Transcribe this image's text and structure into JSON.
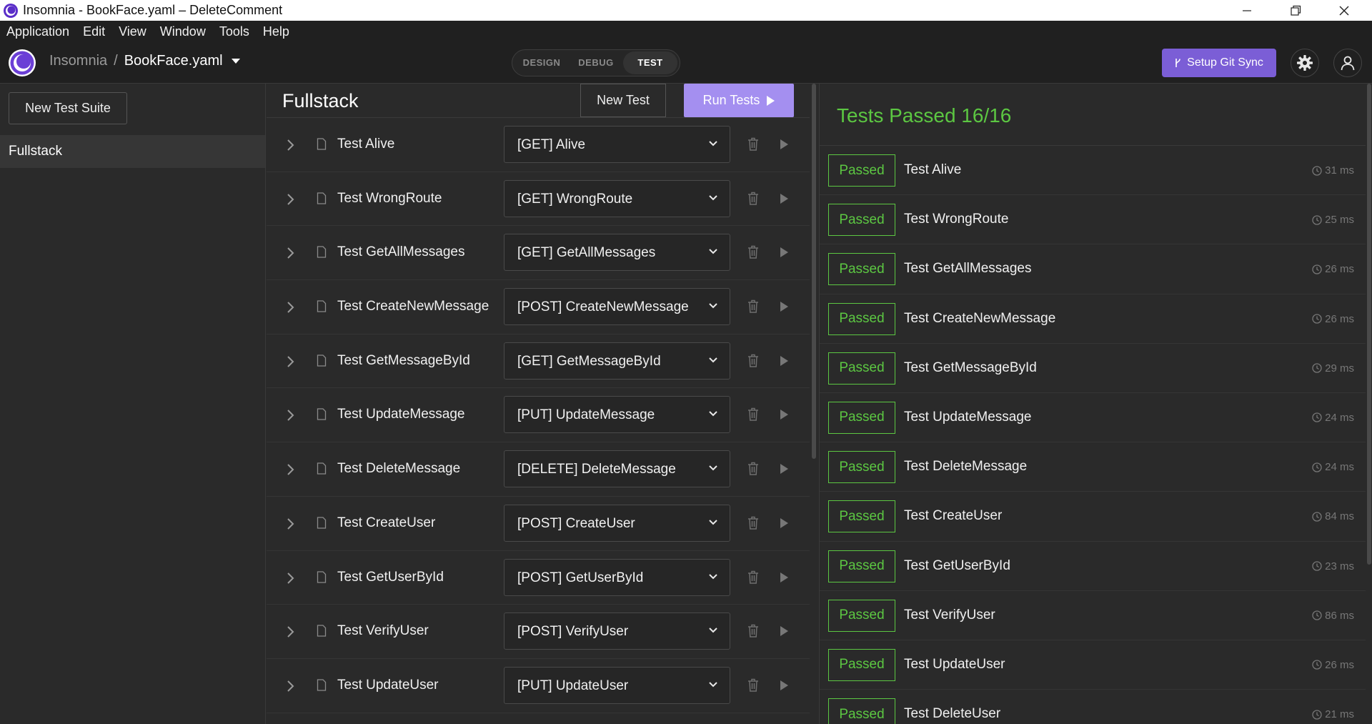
{
  "window": {
    "title": "Insomnia - BookFace.yaml – DeleteComment"
  },
  "menu": [
    "Application",
    "Edit",
    "View",
    "Window",
    "Tools",
    "Help"
  ],
  "header": {
    "breadcrumb_root": "Insomnia",
    "breadcrumb_sep": "/",
    "breadcrumb_file": "BookFace.yaml",
    "modes": [
      "DESIGN",
      "DEBUG",
      "TEST"
    ],
    "active_mode": "TEST",
    "git_sync_label": "Setup Git Sync",
    "accent_color": "#7b5ed6"
  },
  "sidebar": {
    "new_suite_label": "New Test Suite",
    "suites": [
      "Fullstack"
    ]
  },
  "suite": {
    "title": "Fullstack",
    "new_test_label": "New Test",
    "run_tests_label": "Run Tests",
    "tests": [
      {
        "name": "Test Alive",
        "request": "[GET] Alive"
      },
      {
        "name": "Test WrongRoute",
        "request": "[GET] WrongRoute"
      },
      {
        "name": "Test GetAllMessages",
        "request": "[GET] GetAllMessages"
      },
      {
        "name": "Test CreateNewMessage",
        "request": "[POST] CreateNewMessage"
      },
      {
        "name": "Test GetMessageById",
        "request": "[GET] GetMessageById"
      },
      {
        "name": "Test UpdateMessage",
        "request": "[PUT] UpdateMessage"
      },
      {
        "name": "Test DeleteMessage",
        "request": "[DELETE] DeleteMessage"
      },
      {
        "name": "Test CreateUser",
        "request": "[POST] CreateUser"
      },
      {
        "name": "Test GetUserById",
        "request": "[POST] GetUserById"
      },
      {
        "name": "Test VerifyUser",
        "request": "[POST] VerifyUser"
      },
      {
        "name": "Test UpdateUser",
        "request": "[PUT] UpdateUser"
      }
    ]
  },
  "results": {
    "summary": "Tests Passed 16/16",
    "status_color": "#5cc742",
    "items": [
      {
        "status": "Passed",
        "name": "Test Alive",
        "time": "31 ms"
      },
      {
        "status": "Passed",
        "name": "Test WrongRoute",
        "time": "25 ms"
      },
      {
        "status": "Passed",
        "name": "Test GetAllMessages",
        "time": "26 ms"
      },
      {
        "status": "Passed",
        "name": "Test CreateNewMessage",
        "time": "26 ms"
      },
      {
        "status": "Passed",
        "name": "Test GetMessageById",
        "time": "29 ms"
      },
      {
        "status": "Passed",
        "name": "Test UpdateMessage",
        "time": "24 ms"
      },
      {
        "status": "Passed",
        "name": "Test DeleteMessage",
        "time": "24 ms"
      },
      {
        "status": "Passed",
        "name": "Test CreateUser",
        "time": "84 ms"
      },
      {
        "status": "Passed",
        "name": "Test GetUserById",
        "time": "23 ms"
      },
      {
        "status": "Passed",
        "name": "Test VerifyUser",
        "time": "86 ms"
      },
      {
        "status": "Passed",
        "name": "Test UpdateUser",
        "time": "26 ms"
      },
      {
        "status": "Passed",
        "name": "Test DeleteUser",
        "time": "21 ms"
      }
    ]
  }
}
